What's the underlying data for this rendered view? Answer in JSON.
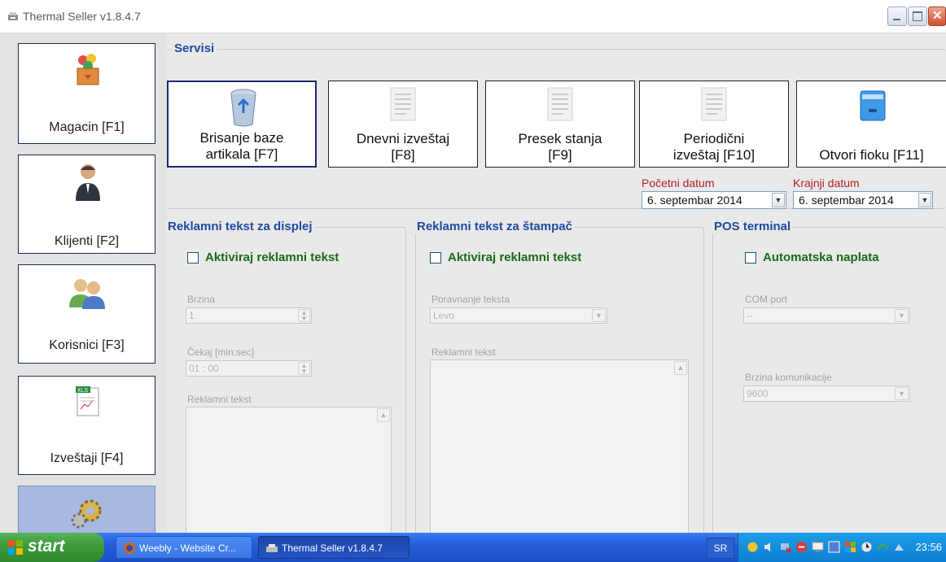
{
  "window": {
    "title": "Thermal Seller v1.8.4.7"
  },
  "sidebar": {
    "items": [
      {
        "label": "Magacin [F1]",
        "icon": "warehouse-box-icon"
      },
      {
        "label": "Klijenti [F2]",
        "icon": "client-person-icon"
      },
      {
        "label": "Korisnici [F3]",
        "icon": "users-icon"
      },
      {
        "label": "Izveštaji [F4]",
        "icon": "xls-report-icon"
      },
      {
        "label": "",
        "icon": "settings-gears-icon",
        "active": true
      }
    ]
  },
  "servisi": {
    "legend": "Servisi",
    "buttons": [
      {
        "label": "Brisanje baze artikala [F7]",
        "icon": "recycle-bin-icon"
      },
      {
        "label": "Dnevni izveštaj [F8]",
        "icon": "document-icon"
      },
      {
        "label": "Presek stanja [F9]",
        "icon": "document-icon"
      },
      {
        "label": "Periodični izveštaj [F10]",
        "icon": "document-icon"
      },
      {
        "label": "Otvori fioku [F11]",
        "icon": "drawer-icon"
      }
    ],
    "start_date_label": "Početni datum",
    "start_date_value": "6. septembar 2014",
    "end_date_label": "Krajnji datum",
    "end_date_value": "6. septembar 2014"
  },
  "display_panel": {
    "legend": "Reklamni tekst za displej",
    "checkbox_label": "Aktiviraj reklamni tekst",
    "brzina_label": "Brzina",
    "brzina_value": "1",
    "cekaj_label": "Čekaj [min:sec]",
    "cekaj_value": "01 : 00",
    "text_label": "Reklamni tekst"
  },
  "printer_panel": {
    "legend": "Reklamni tekst za štampač",
    "checkbox_label": "Aktiviraj reklamni tekst",
    "align_label": "Poravnanje teksta",
    "align_value": "Levo",
    "text_label": "Reklamni tekst"
  },
  "pos_panel": {
    "legend": "POS terminal",
    "checkbox_label": "Automatska naplata",
    "com_label": "COM port",
    "com_value": "--",
    "speed_label": "Brzina komunikacije",
    "speed_value": "9600"
  },
  "taskbar": {
    "start_label": "start",
    "items": [
      {
        "label": "Weebly - Website Cr..."
      },
      {
        "label": "Thermal Seller v1.8.4.7"
      }
    ],
    "language": "SR",
    "clock": "23:56"
  },
  "colors": {
    "accent_blue": "#1f4aa0",
    "date_label_red": "#b0222a",
    "checkbox_green": "#1a6a1a",
    "taskbar_blue": "#245edb",
    "start_green": "#3a9a3a"
  }
}
